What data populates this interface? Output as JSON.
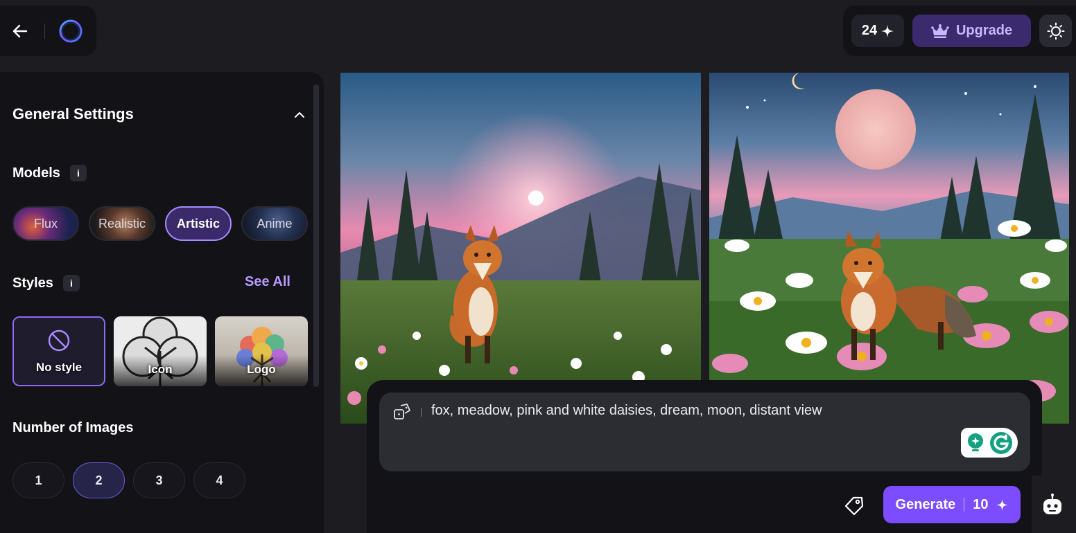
{
  "header": {
    "back_icon": "arrow-left-icon",
    "logo_icon": "ring-logo-icon",
    "credits_count": "24",
    "credits_icon": "sparkle-icon",
    "upgrade_label": "Upgrade",
    "upgrade_icon": "crown-icon",
    "theme_icon": "sun-icon"
  },
  "sidebar": {
    "section_title": "General Settings",
    "collapse_icon": "chevron-up-icon",
    "models_label": "Models",
    "info_glyph": "i",
    "models": [
      {
        "label": "Flux",
        "selected": false
      },
      {
        "label": "Realistic",
        "selected": false
      },
      {
        "label": "Artistic",
        "selected": true
      },
      {
        "label": "Anime",
        "selected": false
      }
    ],
    "styles_label": "Styles",
    "see_all_label": "See All",
    "styles": [
      {
        "label": "No style",
        "icon": "ban-icon",
        "selected": true
      },
      {
        "label": "Icon",
        "selected": false
      },
      {
        "label": "Logo",
        "selected": false
      }
    ],
    "number_label": "Number of Images",
    "numbers": [
      {
        "label": "1",
        "selected": false
      },
      {
        "label": "2",
        "selected": true
      },
      {
        "label": "3",
        "selected": false
      },
      {
        "label": "4",
        "selected": false
      }
    ]
  },
  "gallery": {
    "image_count": 2
  },
  "prompt": {
    "text": "fox, meadow, pink and white daisies, dream, moon, distant view",
    "dice_icon": "dice-icon",
    "grammarly_icons": [
      "bulb-icon",
      "grammarly-g-icon"
    ]
  },
  "actions": {
    "tag_icon": "tag-icon",
    "generate_label": "Generate",
    "generate_cost": "10",
    "bot_icon": "robot-icon"
  },
  "colors": {
    "accent": "#7b4dff",
    "accent_light": "#b79bff",
    "background": "#1c1c21",
    "panel": "#121217"
  }
}
